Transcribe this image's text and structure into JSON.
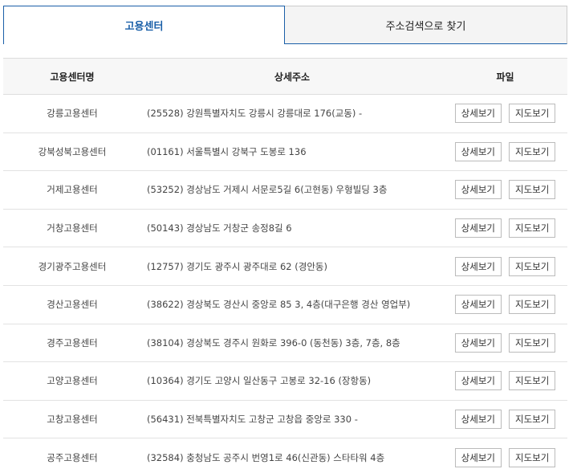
{
  "tabs": [
    {
      "label": "고용센터"
    },
    {
      "label": "주소검색으로 찾기"
    }
  ],
  "table": {
    "headers": {
      "name": "고용센터명",
      "address": "상세주소",
      "file": "파일"
    },
    "detail_label": "상세보기",
    "map_label": "지도보기",
    "rows": [
      {
        "name": "강릉고용센터",
        "address": "(25528) 강원특별자치도 강릉시 강릉대로 176(교동) -"
      },
      {
        "name": "강북성북고용센터",
        "address": "(01161) 서울특별시 강북구 도봉로 136"
      },
      {
        "name": "거제고용센터",
        "address": "(53252) 경상남도 거제시 서문로5길 6(고현동) 우형빌딩 3층"
      },
      {
        "name": "거창고용센터",
        "address": "(50143) 경상남도 거창군 송정8길 6"
      },
      {
        "name": "경기광주고용센터",
        "address": "(12757) 경기도 광주시 광주대로 62 (경안동)"
      },
      {
        "name": "경산고용센터",
        "address": "(38622) 경상북도 경산시 중앙로 85 3, 4층(대구은행 경산 영업부)"
      },
      {
        "name": "경주고용센터",
        "address": "(38104) 경상북도 경주시 원화로 396-0 (동천동) 3층, 7층, 8층"
      },
      {
        "name": "고양고용센터",
        "address": "(10364) 경기도 고양시 일산동구 고봉로 32-16 (장항동)"
      },
      {
        "name": "고창고용센터",
        "address": "(56431) 전북특별자치도 고창군 고창읍 중앙로 330 -"
      },
      {
        "name": "공주고용센터",
        "address": "(32584) 충청남도 공주시 번영1로 46(신관동) 스타타워 4층"
      }
    ]
  }
}
